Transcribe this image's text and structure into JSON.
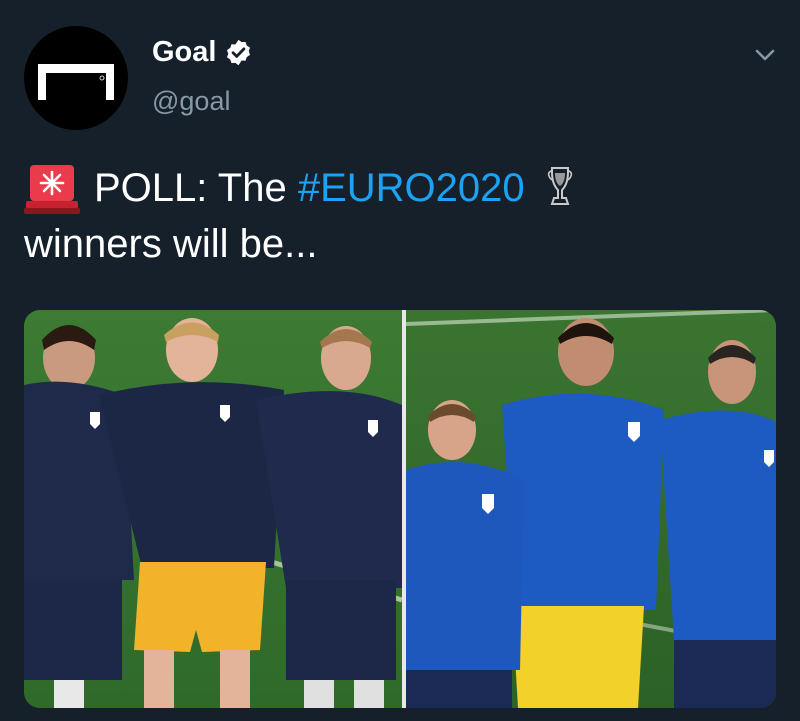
{
  "account": {
    "display_name": "Goal",
    "handle": "@goal",
    "verified_icon": "verified-badge-icon",
    "avatar_icon": "goal-logo-icon"
  },
  "menu": {
    "icon": "chevron-down-icon"
  },
  "tweet": {
    "siren": "siren-emoji",
    "text_prefix": "POLL: The ",
    "hashtag": "#EURO2020",
    "trophy": "trophy-emoji",
    "line2": "winners will be..."
  },
  "media": {
    "image": "england-vs-italy-players-anthem-photo"
  },
  "colors": {
    "background": "#15202b",
    "text": "#ffffff",
    "muted": "#8899a6",
    "link": "#1da1f2"
  }
}
